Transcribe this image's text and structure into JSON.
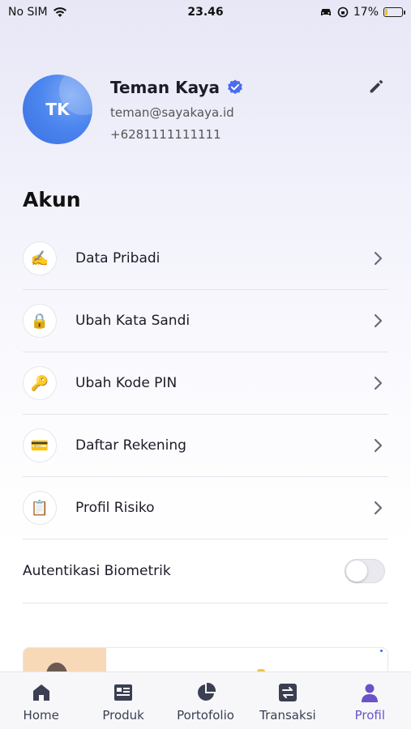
{
  "status_bar": {
    "carrier": "No SIM",
    "time": "23.46",
    "battery": "17%",
    "battery_level": 0.17
  },
  "profile": {
    "initials": "TK",
    "name": "Teman Kaya",
    "email": "teman@sayakaya.id",
    "phone": "+6281111111111"
  },
  "section_title": "Akun",
  "menu": [
    {
      "label": "Data Pribadi",
      "icon": "✍️"
    },
    {
      "label": "Ubah Kata Sandi",
      "icon": "🔒"
    },
    {
      "label": "Ubah Kode PIN",
      "icon": "🔑"
    },
    {
      "label": "Daftar Rekening",
      "icon": "💳"
    },
    {
      "label": "Profil Risiko",
      "icon": "📋"
    }
  ],
  "biometric": {
    "label": "Autentikasi Biometrik",
    "enabled": false
  },
  "nav": [
    {
      "label": "Home"
    },
    {
      "label": "Produk"
    },
    {
      "label": "Portofolio"
    },
    {
      "label": "Transaksi"
    },
    {
      "label": "Profil",
      "active": true
    }
  ],
  "colors": {
    "accent": "#6a52c9",
    "nav_default": "#3a3f52",
    "avatar": "#4c86ef",
    "verified": "#4a6cf0"
  }
}
